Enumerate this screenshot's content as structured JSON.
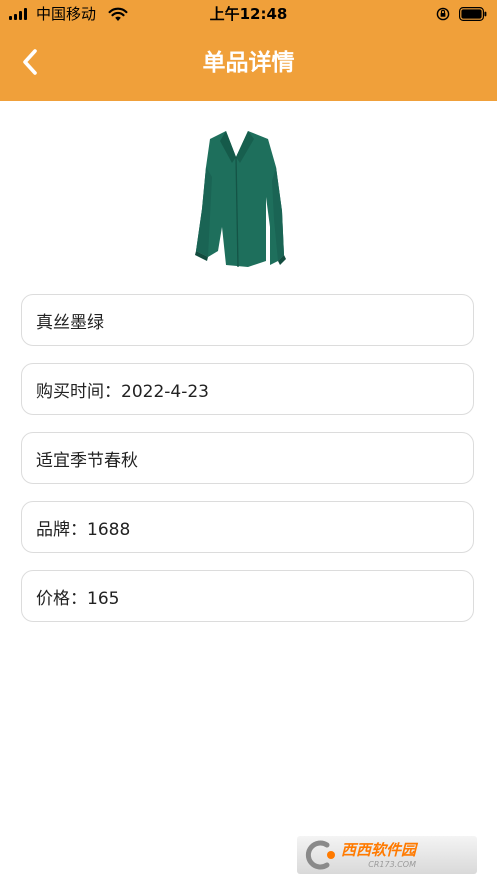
{
  "status_bar": {
    "carrier": "中国移动",
    "time": "上午12:48"
  },
  "nav": {
    "title": "单品详情"
  },
  "product": {
    "name": "真丝墨绿",
    "purchase_time": "购买时间：2022-4-23",
    "season": "适宜季节春秋",
    "brand": "品牌：1688",
    "price": "价格：165"
  },
  "watermark": {
    "logo_text": "西西软件园",
    "sub_text": "CR173.COM"
  },
  "colors": {
    "header": "#F0A03A",
    "card_border": "#dcdcdc",
    "garment": "#1E6F5C"
  }
}
